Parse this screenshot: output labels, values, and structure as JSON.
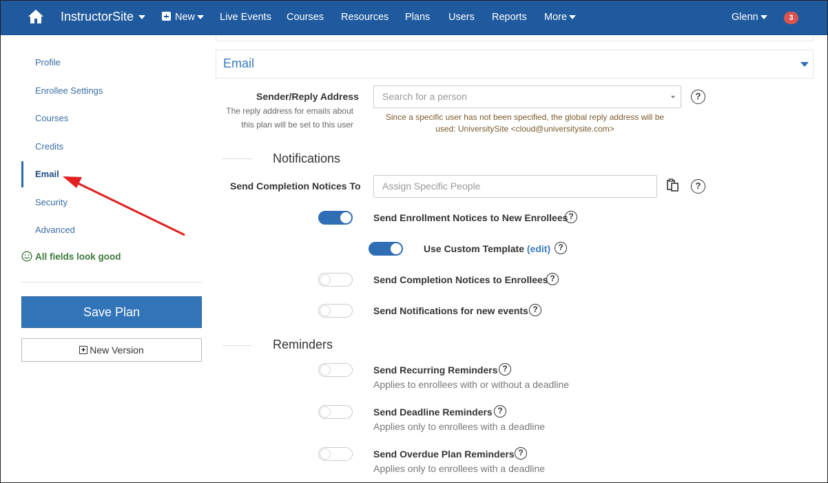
{
  "nav": {
    "brand": "InstructorSite",
    "new_label": "New",
    "items": [
      "Live Events",
      "Courses",
      "Resources",
      "Plans",
      "Users",
      "Reports"
    ],
    "more_label": "More",
    "user": "Glenn",
    "notification_count": "3",
    "bar_color": "#1f5a9e"
  },
  "sidebar": {
    "items": [
      "Profile",
      "Enrollee Settings",
      "Courses",
      "Credits",
      "Email",
      "Security",
      "Advanced"
    ],
    "active": "Email",
    "status": "All fields look good",
    "save_label": "Save Plan",
    "new_version_label": "New Version"
  },
  "panel": {
    "title": "Email"
  },
  "sender": {
    "label": "Sender/Reply Address",
    "help_line1": "The reply address for emails about",
    "help_line2": "this plan will be set to this user",
    "placeholder": "Search for a person",
    "note_line1": "Since a specific user has not been specified, the global reply address will be",
    "note_line2": "used: UniversitySite <cloud@universitysite.com>"
  },
  "notifications": {
    "title": "Notifications",
    "completion_to_label": "Send Completion Notices To",
    "completion_to_placeholder": "Assign Specific People",
    "enrollment_notices": {
      "label": "Send Enrollment Notices to New Enrollees",
      "on": true
    },
    "custom_template": {
      "label": "Use Custom Template",
      "edit": "(edit)",
      "on": true
    },
    "completion_notices": {
      "label": "Send Completion Notices to Enrollees",
      "on": false
    },
    "new_events": {
      "label": "Send Notifications for new events",
      "on": false
    }
  },
  "reminders": {
    "title": "Reminders",
    "recurring": {
      "label": "Send Recurring Reminders",
      "sub": "Applies to enrollees with or without a deadline",
      "on": false
    },
    "deadline": {
      "label": "Send Deadline Reminders",
      "sub": "Applies only to enrollees with a deadline",
      "on": false
    },
    "overdue": {
      "label": "Send Overdue Plan Reminders",
      "sub": "Applies only to enrollees with a deadline",
      "on": false
    }
  },
  "help_glyph": "?",
  "accent_color": "#2f6db5",
  "annotation_arrow_color": "#e02020"
}
